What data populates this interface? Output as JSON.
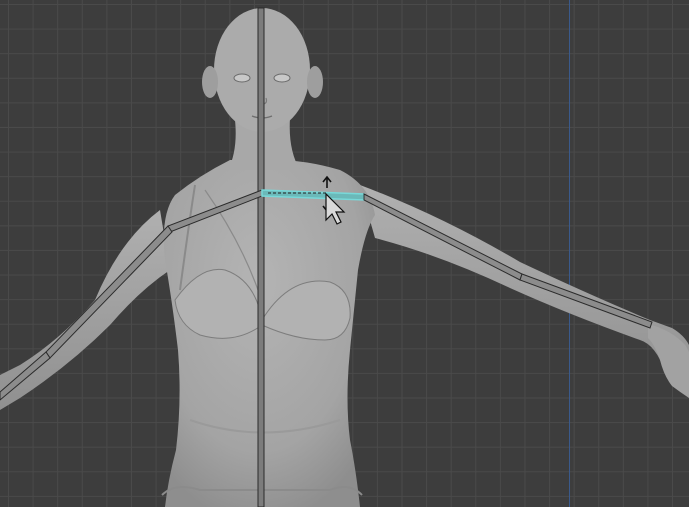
{
  "viewport": {
    "type": "3d-viewport",
    "mode": "armature-edit",
    "grid_visible": true,
    "colors": {
      "background": "#3d3d3d",
      "grid_minor": "#4a4a4a",
      "axis_y": "#3a5a8c",
      "mesh": "#a7a7a7",
      "bone": "#8a8a8a",
      "bone_selected": "#78d8d8"
    }
  },
  "model": {
    "name": "female-base-mesh",
    "shading": "solid-grey"
  },
  "bones": [
    {
      "name": "spine",
      "selected": false
    },
    {
      "name": "clavicle-left",
      "selected": true
    },
    {
      "name": "upper-arm-left",
      "selected": false
    },
    {
      "name": "forearm-left",
      "selected": false
    },
    {
      "name": "clavicle-right",
      "selected": false
    },
    {
      "name": "upper-arm-right",
      "selected": false
    },
    {
      "name": "forearm-right",
      "selected": false
    }
  ],
  "cursor": {
    "type": "arrow-with-transform-arrows"
  }
}
